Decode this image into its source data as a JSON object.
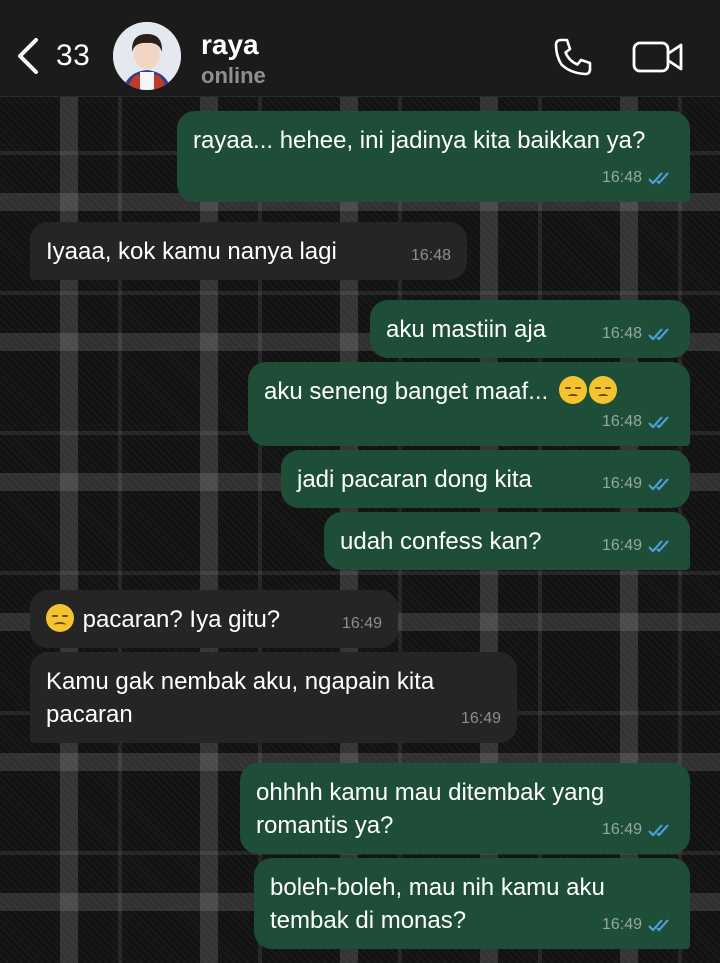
{
  "header": {
    "back_count": "33",
    "contact_name": "raya",
    "contact_status": "online",
    "icons": [
      "chevron-left-icon",
      "phone-icon",
      "video-camera-icon"
    ]
  },
  "colors": {
    "outgoing_bubble": "#1f4e38",
    "incoming_bubble": "#252525",
    "read_ticks": "#4fa3e0",
    "header_bg": "#1b1b1b"
  },
  "messages": [
    {
      "dir": "out",
      "text": "rayaa... hehee, ini jadinya kita baikkan ya?",
      "time": "16:48"
    },
    {
      "dir": "in",
      "text": "Iyaaa, kok kamu nanya lagi",
      "time": "16:48"
    },
    {
      "dir": "out",
      "text": "aku mastiin aja",
      "time": "16:48"
    },
    {
      "dir": "out",
      "text": "aku seneng banget maaf...",
      "emoji": "pensive-face x2",
      "time": "16:48"
    },
    {
      "dir": "out",
      "text": "jadi pacaran dong kita",
      "time": "16:49"
    },
    {
      "dir": "out",
      "text": "udah confess kan?",
      "time": "16:49"
    },
    {
      "dir": "in",
      "emoji": "worried-face",
      "text": "pacaran? Iya gitu?",
      "time": "16:49"
    },
    {
      "dir": "in",
      "text": "Kamu gak nembak aku, ngapain kita pacaran",
      "time": "16:49"
    },
    {
      "dir": "out",
      "text": "ohhhh kamu mau ditembak yang romantis ya?",
      "time": "16:49"
    },
    {
      "dir": "out",
      "text": "boleh-boleh, mau nih kamu aku tembak di monas?",
      "time": "16:49"
    }
  ]
}
